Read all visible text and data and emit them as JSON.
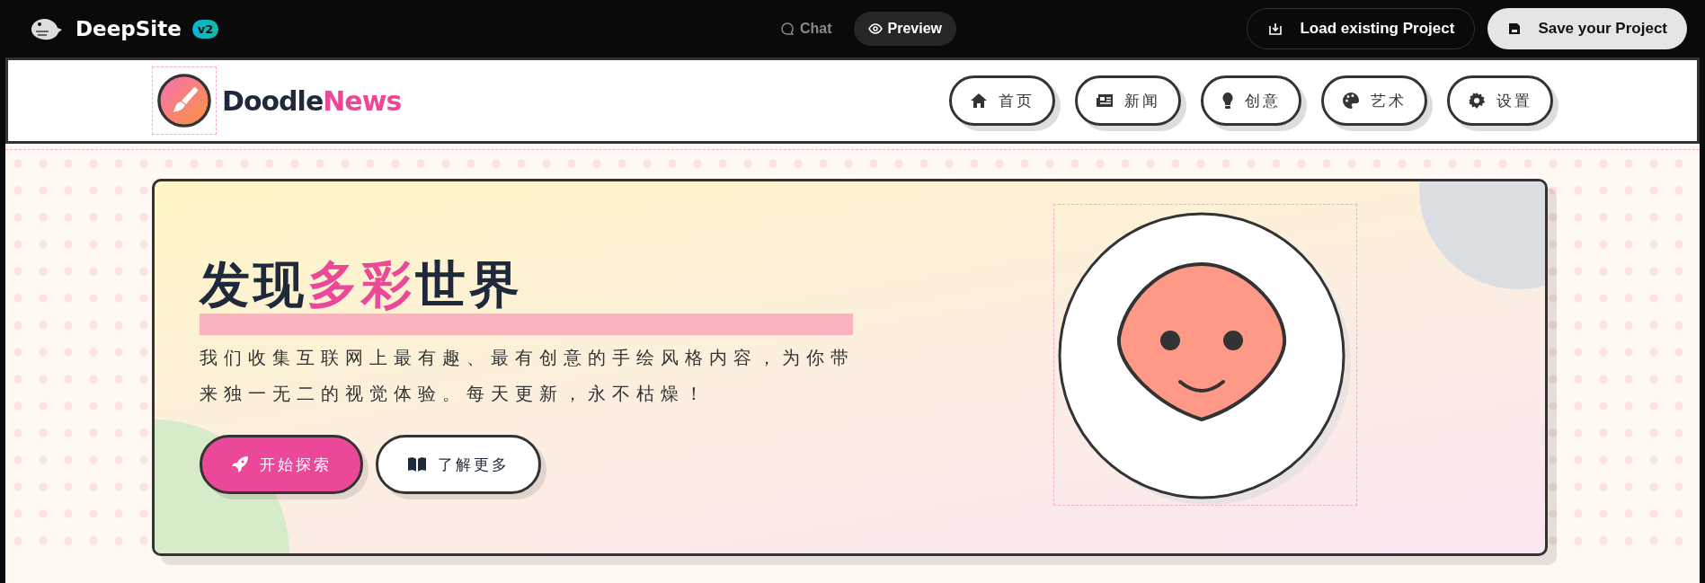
{
  "app_bar": {
    "brand": "DeepSite",
    "badge": "v2",
    "tabs": [
      {
        "label": "Chat",
        "selected": false
      },
      {
        "label": "Preview",
        "selected": true
      }
    ],
    "buttons": [
      {
        "label": "Load existing Project",
        "kind": "outline"
      },
      {
        "label": "Save your Project",
        "kind": "solid"
      }
    ]
  },
  "site_header": {
    "logo_parts": [
      "Doodle",
      "News"
    ],
    "nav": [
      {
        "label": "首页"
      },
      {
        "label": "新闻"
      },
      {
        "label": "创意"
      },
      {
        "label": "艺术"
      },
      {
        "label": "设置"
      }
    ]
  },
  "hero": {
    "title_parts": [
      "发现",
      "多彩",
      "世界"
    ],
    "text": "我们收集互联网上最有趣、最有创意的手绘风格内容，为你带来独一无二的视觉体验。每天更新，永不枯燥！",
    "buttons": [
      {
        "label": "开始探索",
        "kind": "primary"
      },
      {
        "label": "了解更多",
        "kind": "secondary"
      }
    ]
  }
}
